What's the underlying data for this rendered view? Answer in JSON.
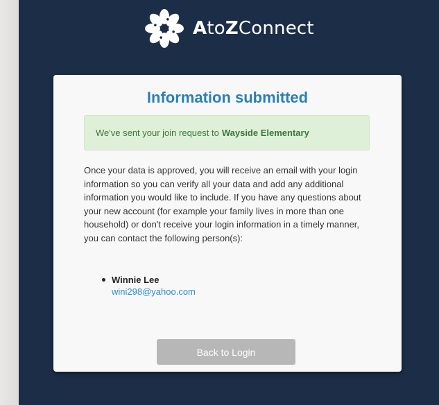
{
  "app": {
    "brand_colors": {
      "background": "#1c2d47",
      "title": "#2a7fb3",
      "success_bg": "#dff0d8",
      "success_text": "#3c763d",
      "link": "#2a8bd0",
      "button": "#b7b7b7"
    },
    "logo": {
      "icon": "flower-logo-icon",
      "text_a": "A",
      "text_to": "to",
      "text_z": "Z",
      "text_connect": "Connect"
    }
  },
  "card": {
    "title": "Information submitted",
    "notice_prefix": "We've sent your join request to",
    "notice_school": "Wayside Elementary",
    "body": "Once your data is approved, you will receive an email with your login information so you can verify all your data and add any additional information you would like to include. If you have any questions about your new account (for example your family lives in more than one household) or don't receive your login information in a timely manner, you can contact the following person(s):",
    "contacts": [
      {
        "name": "Winnie Lee",
        "email": "wini298@yahoo.com"
      }
    ],
    "back_button": "Back to Login"
  }
}
